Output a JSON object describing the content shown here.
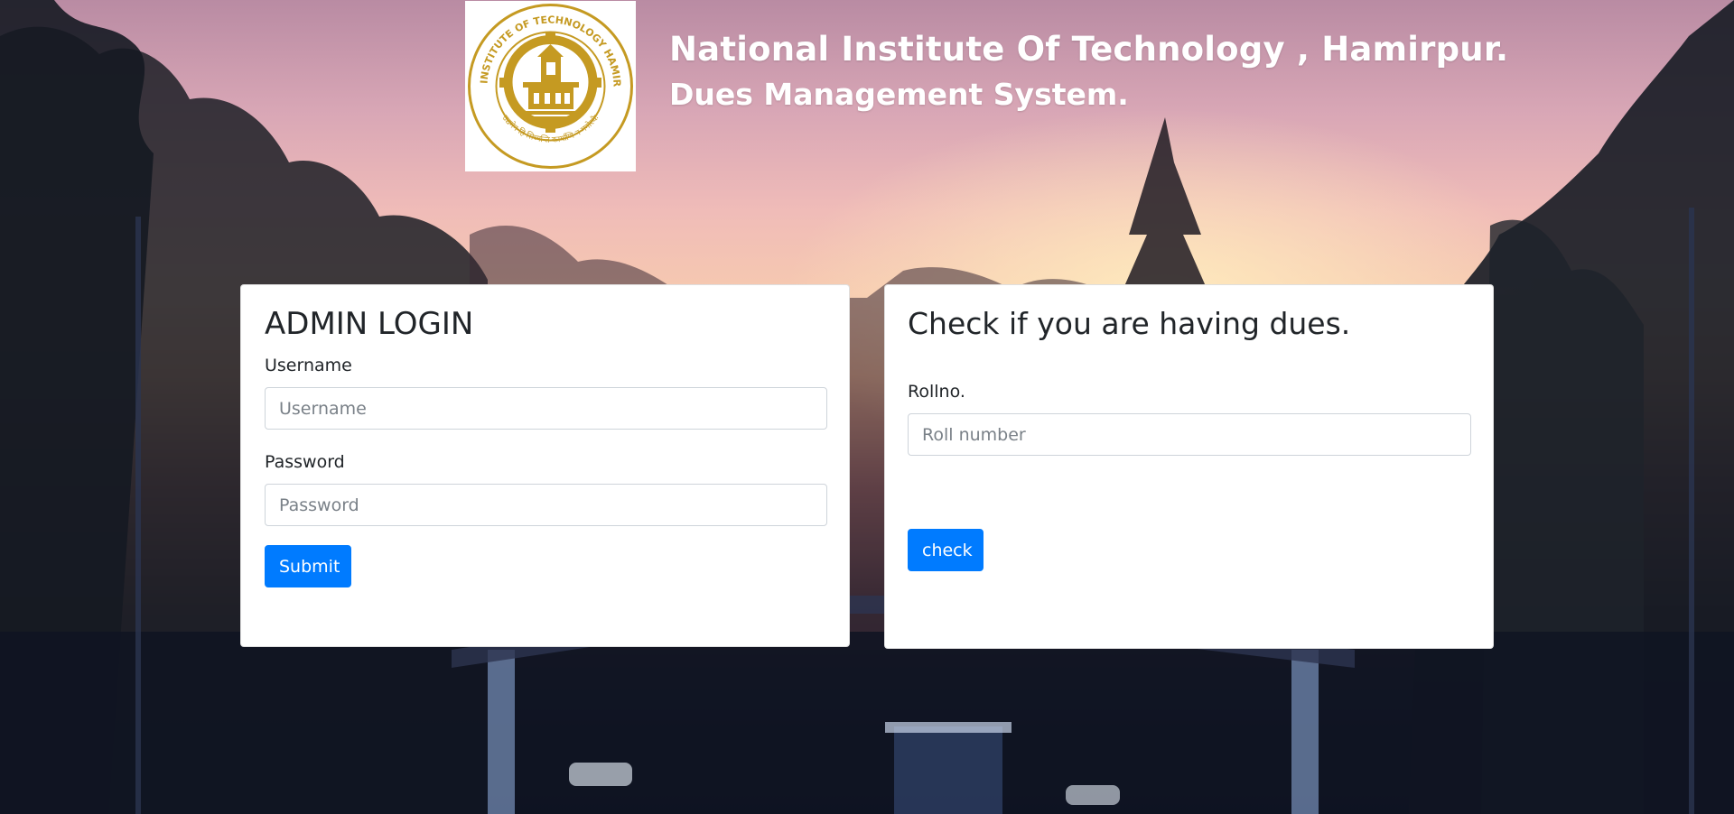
{
  "header": {
    "institute_name": "National Institute Of Technology , Hamirpur.",
    "system_name": "Dues Management System.",
    "logo": {
      "icon": "institute-seal-icon",
      "ring_text": "NATIONAL INSTITUTE OF TECHNOLOGY HAMIRPUR (H.P.)",
      "motto": "उद्यमेन हि सिध्यन्ति कार्याणि न मनोरथैः",
      "color": "#c59a22"
    }
  },
  "admin_login": {
    "heading": "ADMIN LOGIN",
    "username_label": "Username",
    "username_placeholder": "Username",
    "username_value": "",
    "password_label": "Password",
    "password_placeholder": "Password",
    "password_value": "",
    "submit_label": "Submit"
  },
  "dues_check": {
    "heading": "Check if you are having dues.",
    "rollno_label": "Rollno.",
    "rollno_placeholder": "Roll number",
    "rollno_value": "",
    "check_label": "check"
  },
  "colors": {
    "primary_button": "#007bff",
    "card_background": "#ffffff",
    "header_text": "#ffffff"
  }
}
